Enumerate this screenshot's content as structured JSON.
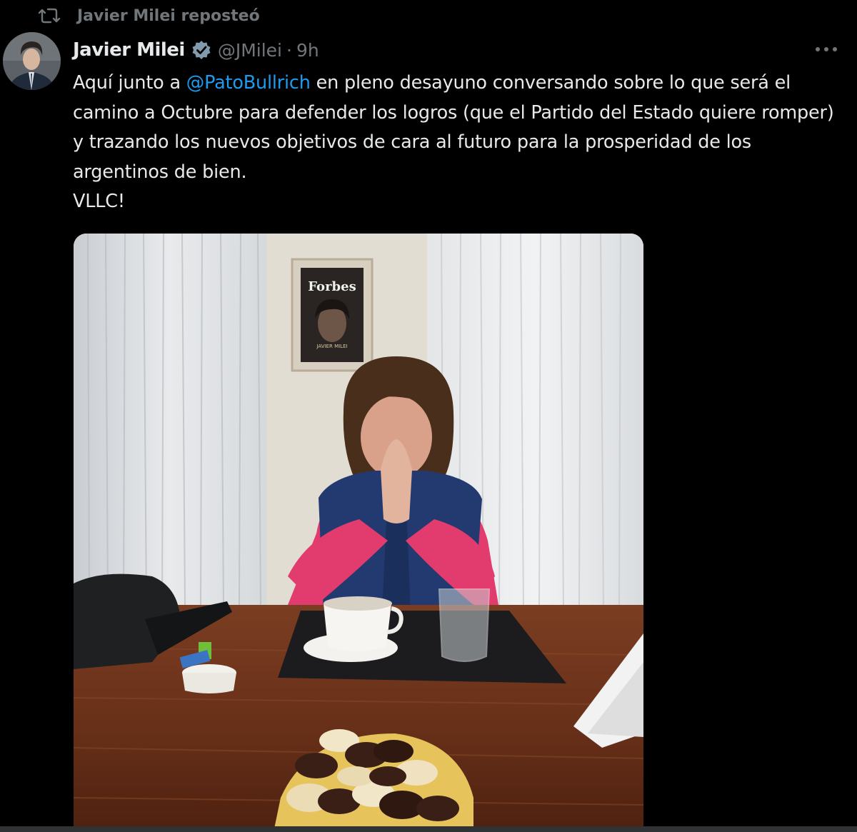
{
  "repost": {
    "label": "Javier Milei reposteó",
    "icon": "repost-icon"
  },
  "author": {
    "name": "Javier Milei",
    "handle": "@JMilei",
    "separator": "·",
    "time": "9h",
    "verified_icon": "verified-badge-icon",
    "avatar_icon": "avatar"
  },
  "more_icon": "more-options-icon",
  "tweet": {
    "text_before": "Aquí junto a ",
    "mention": "@PatoBullrich",
    "text_after": " en pleno desayuno conversando sobre lo que será el camino a Octubre para defender los logros (que el Partido del Estado quiere romper) y trazando los nuevos objetivos de cara al futuro para la prosperidad de los argentinos de bien.",
    "closing": "VLLC!"
  },
  "media": {
    "poster_brand": "Forbes",
    "poster_caption": "JAVIER MILEI"
  },
  "colors": {
    "background": "#000000",
    "text_primary": "#e7e9ea",
    "text_secondary": "#71767b",
    "link": "#1d9bf0",
    "verified": "#829aab"
  }
}
